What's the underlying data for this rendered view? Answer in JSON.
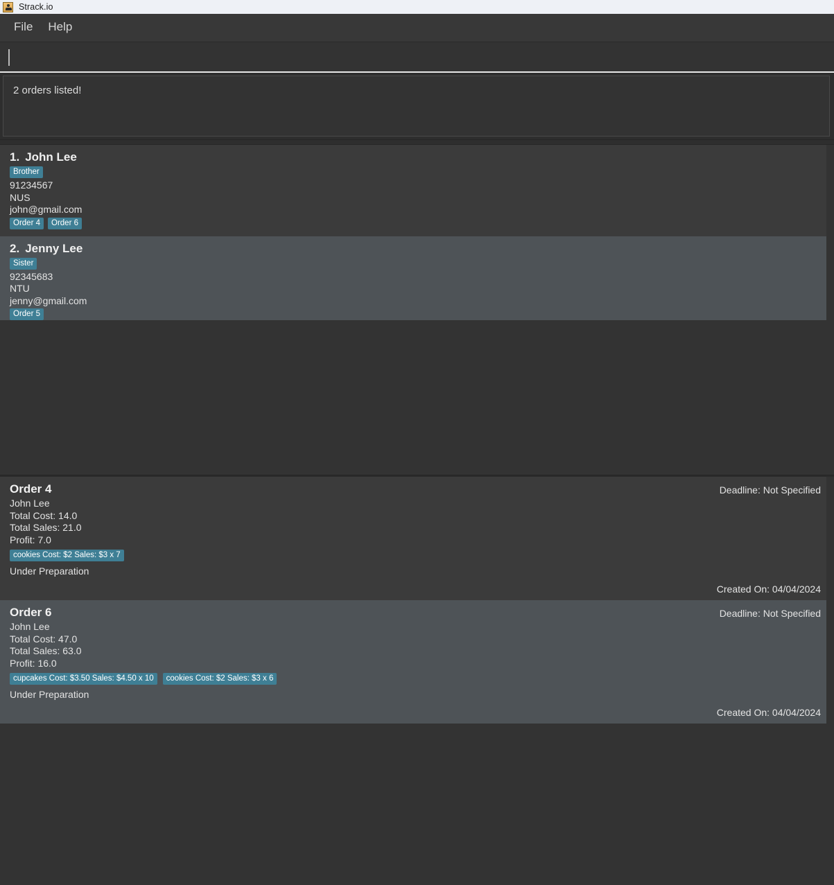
{
  "window": {
    "title": "Strack.io",
    "icon": "java-app-icon"
  },
  "menubar": {
    "items": [
      {
        "label": "File"
      },
      {
        "label": "Help"
      }
    ]
  },
  "command_input": {
    "value": "",
    "placeholder": ""
  },
  "result_display": {
    "message": "2 orders listed!"
  },
  "person_list": {
    "persons": [
      {
        "index": "1.",
        "name": "John Lee",
        "relationship_tag": "Brother",
        "phone": "91234567",
        "address": "NUS",
        "email": "john@gmail.com",
        "order_tags": [
          "Order 4",
          "Order 6"
        ]
      },
      {
        "index": "2.",
        "name": "Jenny Lee",
        "relationship_tag": "Sister",
        "phone": "92345683",
        "address": "NTU",
        "email": "jenny@gmail.com",
        "order_tags": [
          "Order 5"
        ]
      }
    ]
  },
  "order_list": {
    "orders": [
      {
        "title": "Order 4",
        "customer": "John Lee",
        "total_cost": "Total Cost: 14.0",
        "total_sales": "Total Sales: 21.0",
        "profit": "Profit: 7.0",
        "items": [
          "cookies Cost: $2 Sales: $3 x 7"
        ],
        "status": "Under Preparation",
        "deadline": "Deadline: Not Specified",
        "created_on": "Created On: 04/04/2024"
      },
      {
        "title": "Order 6",
        "customer": "John Lee",
        "total_cost": "Total Cost: 47.0",
        "total_sales": "Total Sales: 63.0",
        "profit": "Profit: 16.0",
        "items": [
          "cupcakes Cost: $3.50 Sales: $4.50 x 10",
          "cookies Cost: $2 Sales: $3 x 6"
        ],
        "status": "Under Preparation",
        "deadline": "Deadline: Not Specified",
        "created_on": "Created On: 04/04/2024"
      }
    ]
  },
  "colors": {
    "tag_accent": "#3f7f95",
    "window_bg": "#333333",
    "card_bg": "#3b3b3b",
    "card_bg_alt": "#4e5357",
    "titlebar_bg": "#eef1f6"
  }
}
